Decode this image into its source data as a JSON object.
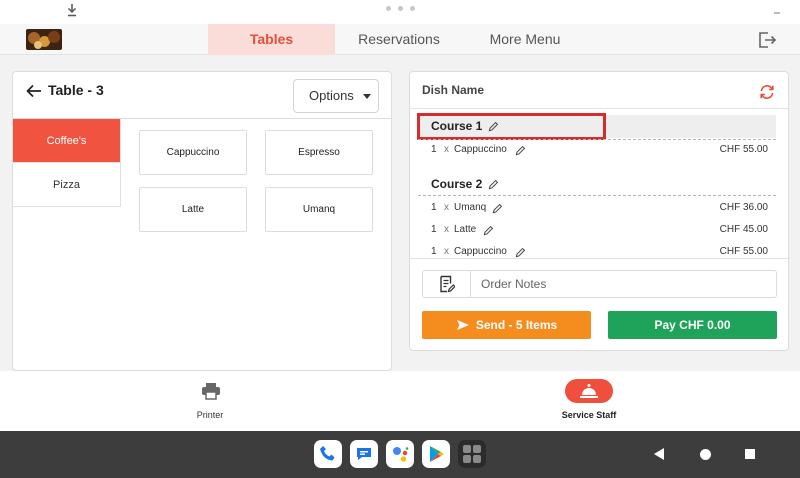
{
  "nav": {
    "tabs": [
      "Tables",
      "Reservations",
      "More Menu"
    ],
    "active_tab": "Tables",
    "accent_color": "#e4503b"
  },
  "left_panel": {
    "title": "Table - 3",
    "options_label": "Options",
    "categories": [
      "Coffee's",
      "Pizza"
    ],
    "selected_category": "Coffee's",
    "products": [
      "Cappuccino",
      "Espresso",
      "Latte",
      "Umanq"
    ]
  },
  "order": {
    "header": "Dish Name",
    "courses": [
      {
        "label": "Course 1",
        "items": [
          {
            "qty": "1",
            "x": "x",
            "name": "Cappuccino",
            "price": "CHF 55.00"
          }
        ]
      },
      {
        "label": "Course 2",
        "items": [
          {
            "qty": "1",
            "x": "x",
            "name": "Umanq",
            "price": "CHF 36.00"
          },
          {
            "qty": "1",
            "x": "x",
            "name": "Latte",
            "price": "CHF 45.00"
          },
          {
            "qty": "1",
            "x": "x",
            "name": "Cappuccino",
            "price": "CHF 55.00"
          }
        ]
      }
    ],
    "notes_placeholder": "Order Notes",
    "send_label": "Send - 5 Items",
    "pay_label": "Pay CHF 0.00",
    "send_color": "#f58c1e",
    "pay_color": "#1fa35a"
  },
  "bottom": {
    "printer_label": "Printer",
    "staff_label": "Service Staff"
  },
  "icons": [
    "download-icon",
    "exit-icon",
    "back-arrow-icon",
    "caret-down-icon",
    "refresh-icon",
    "pencil-icon",
    "notes-icon",
    "send-icon",
    "printer-icon",
    "service-bell-icon",
    "phone-icon",
    "messages-icon",
    "assistant-icon",
    "play-store-icon",
    "apps-icon"
  ]
}
